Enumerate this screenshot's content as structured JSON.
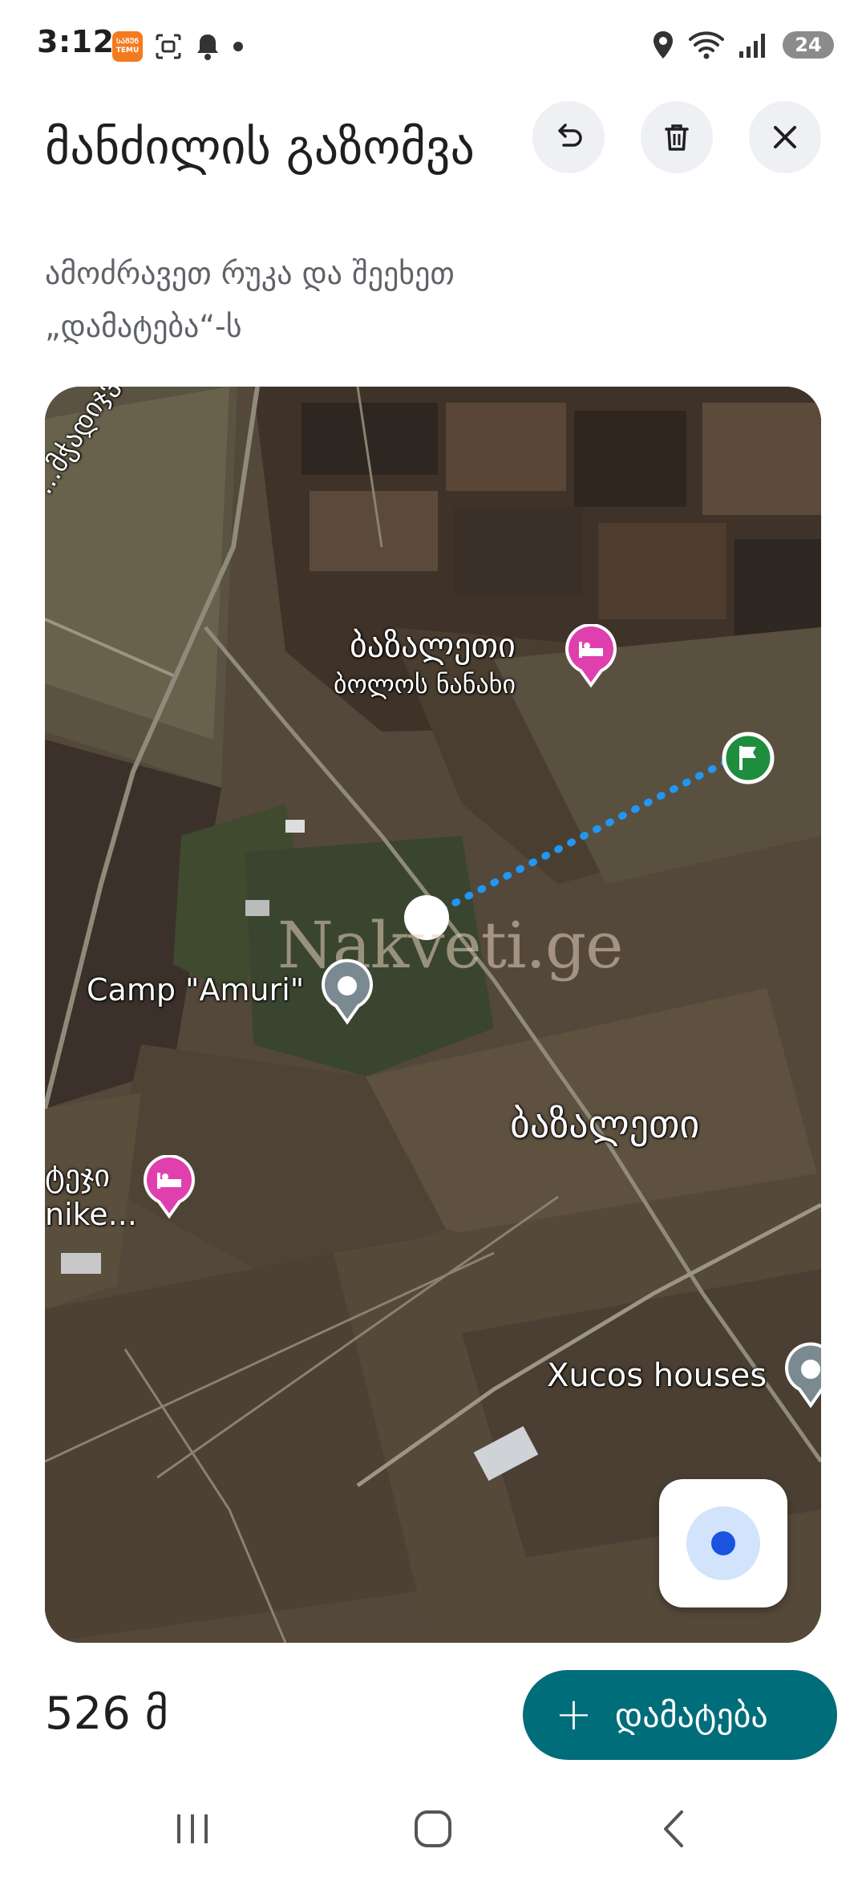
{
  "status_bar": {
    "time": "3:12",
    "temu_label_top": "ᲡᲐᲨᲣᲜ",
    "temu_label": "TEMU",
    "battery": "24"
  },
  "header": {
    "title": "მანძილის გაზომვა",
    "subtitle": "ამოძრავეთ რუკა და შეეხეთ „დამატება“-ს",
    "undo_icon": "undo-icon",
    "delete_icon": "trash-icon",
    "close_icon": "close-icon"
  },
  "map": {
    "labels": {
      "village_top": "ბაზალეთი",
      "village_sub": "ბოლოს ნანახი",
      "camp": "Camp \"Amuri\"",
      "village_big": "ბაზალეთი",
      "left_line1": "ტეჯი",
      "left_line2": "nike...",
      "xucos": "Xucos houses",
      "road": "...მჭადიჯვარი"
    },
    "watermark": "Nakveti.ge",
    "accent_colors": {
      "measure_line": "#2196f3",
      "flag_pin": "#1e8e3e",
      "hotel_pin": "#e040ad",
      "poi_pin": "#7a8a90"
    }
  },
  "footer": {
    "distance": "526 მ",
    "add_label": "დამატება",
    "add_icon": "+",
    "button_color": "#006d7a"
  }
}
